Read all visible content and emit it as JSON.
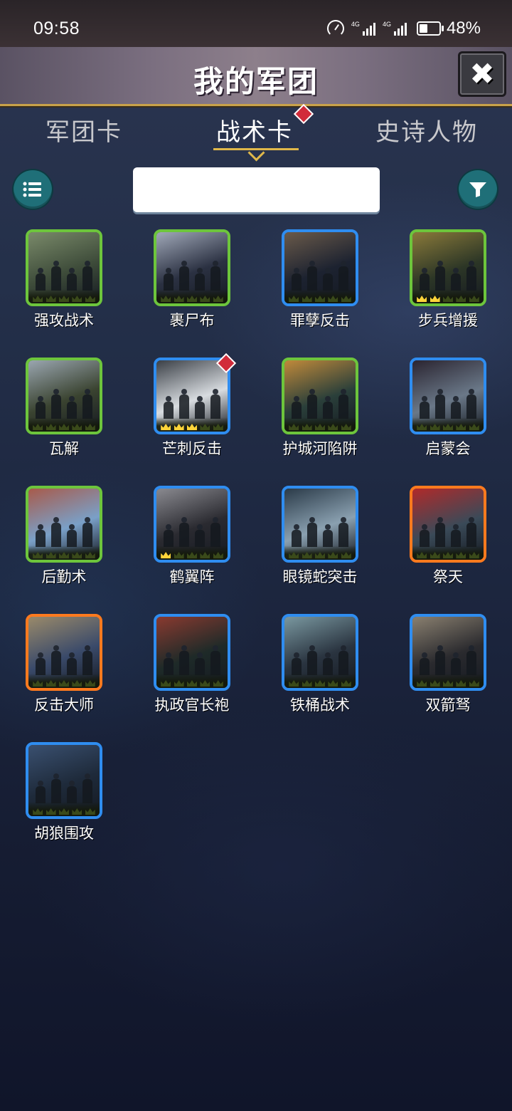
{
  "status_bar": {
    "time": "09:58",
    "battery": "48%",
    "net1": "4G",
    "net2": "4G",
    "battery_level": 0.48
  },
  "header": {
    "title": "我的军团",
    "close_icon": "close-icon"
  },
  "tabs": [
    {
      "label": "军团卡",
      "active": false
    },
    {
      "label": "战术卡",
      "active": true,
      "badge": true
    },
    {
      "label": "史诗人物",
      "active": false
    }
  ],
  "toolbar": {
    "menu_icon": "list-icon",
    "filter_icon": "filter-icon",
    "search_placeholder": "",
    "search_value": ""
  },
  "cards": [
    {
      "name": "强攻战术",
      "rarity": "green",
      "stars": 0,
      "art": [
        "#3e4c3a",
        "#7a8a6a"
      ]
    },
    {
      "name": "裹尸布",
      "rarity": "green",
      "stars": 0,
      "art": [
        "#2b3142",
        "#a0a8b8"
      ]
    },
    {
      "name": "罪孽反击",
      "rarity": "blue",
      "stars": 0,
      "art": [
        "#1c2230",
        "#6a5a4a"
      ]
    },
    {
      "name": "步兵增援",
      "rarity": "green",
      "stars": 2,
      "art": [
        "#2c3626",
        "#8a7a3a"
      ]
    },
    {
      "name": "瓦解",
      "rarity": "green",
      "stars": 0,
      "art": [
        "#3a4330",
        "#9aa6b0"
      ]
    },
    {
      "name": "芒刺反击",
      "rarity": "blue",
      "stars": 3,
      "art": [
        "#d8dce0",
        "#3a3f46"
      ],
      "badge": true
    },
    {
      "name": "护城河陷阱",
      "rarity": "green",
      "stars": 0,
      "art": [
        "#2a3f3a",
        "#c08a3a"
      ]
    },
    {
      "name": "启蒙会",
      "rarity": "blue",
      "stars": 0,
      "art": [
        "#6a7888",
        "#2a2430"
      ]
    },
    {
      "name": "后勤术",
      "rarity": "green",
      "stars": 0,
      "art": [
        "#7aa0c8",
        "#a85a4a"
      ]
    },
    {
      "name": "鹤翼阵",
      "rarity": "blue",
      "stars": 1,
      "art": [
        "#2a2a30",
        "#8a8a90"
      ]
    },
    {
      "name": "眼镜蛇突击",
      "rarity": "blue",
      "stars": 0,
      "art": [
        "#8aa0b0",
        "#2a3a48"
      ]
    },
    {
      "name": "祭天",
      "rarity": "orange",
      "stars": 0,
      "art": [
        "#3a4a58",
        "#b02a2a"
      ]
    },
    {
      "name": "反击大师",
      "rarity": "orange",
      "stars": 0,
      "art": [
        "#3a4a6a",
        "#9a8a6a"
      ]
    },
    {
      "name": "执政官长袍",
      "rarity": "blue",
      "stars": 0,
      "art": [
        "#1e2a28",
        "#8a3a30"
      ]
    },
    {
      "name": "铁桶战术",
      "rarity": "blue",
      "stars": 0,
      "art": [
        "#2a3440",
        "#7a98a0"
      ]
    },
    {
      "name": "双箭驽",
      "rarity": "blue",
      "stars": 0,
      "art": [
        "#2a2a2e",
        "#8a8070"
      ]
    },
    {
      "name": "胡狼围攻",
      "rarity": "blue",
      "stars": 0,
      "art": [
        "#1e2a3a",
        "#3a5070"
      ]
    }
  ]
}
